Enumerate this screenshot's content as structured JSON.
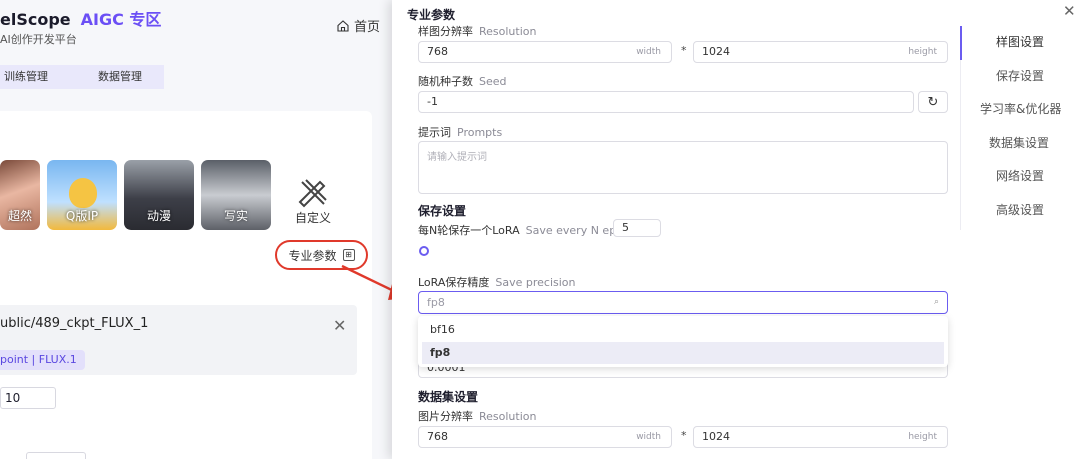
{
  "background": {
    "brand_name": "elScope",
    "brand_aigc": "AIGC 专区",
    "brand_sub": "AI创作开发平台",
    "home_label": "首页",
    "nav_tabs": [
      "训练管理",
      "数据管理"
    ],
    "styles": [
      "超然",
      "Q版IP",
      "动漫",
      "写实",
      "自定义"
    ],
    "pro_params_label": "专业参数",
    "ckpt_path": "ublic/489_ckpt_FLUX_1",
    "ckpt_tag": "point | FLUX.1",
    "value_input": "10"
  },
  "drawer": {
    "title": "专业参数",
    "resolution_label": "样图分辨率",
    "resolution_label_en": "Resolution",
    "width_value": "768",
    "width_suffix": "width",
    "height_value": "1024",
    "height_suffix": "height",
    "times_symbol": "*",
    "seed_label": "随机种子数",
    "seed_label_en": "Seed",
    "seed_value": "-1",
    "prompts_label": "提示词",
    "prompts_label_en": "Prompts",
    "prompts_placeholder": "请输入提示词",
    "save_section_title": "保存设置",
    "save_every_label": "每N轮保存一个LoRA",
    "save_every_label_en": "Save every N epochs",
    "save_every_value": "5",
    "save_every_fraction": 0.0,
    "precision_label": "LoRA保存精度",
    "precision_label_en": "Save precision",
    "precision_selected": "fp8",
    "precision_options": [
      "bf16",
      "fp8"
    ],
    "lr_value": "0.0001",
    "dataset_section_title": "数据集设置",
    "img_res_label": "图片分辨率",
    "img_res_label_en": "Resolution",
    "img_width_value": "768",
    "img_height_value": "1024"
  },
  "side_nav": {
    "items": [
      "样图设置",
      "保存设置",
      "学习率&优化器",
      "数据集设置",
      "网络设置",
      "高级设置"
    ],
    "active": "样图设置"
  },
  "colors": {
    "accent": "#6b5cf0",
    "highlight": "#e0392b"
  }
}
